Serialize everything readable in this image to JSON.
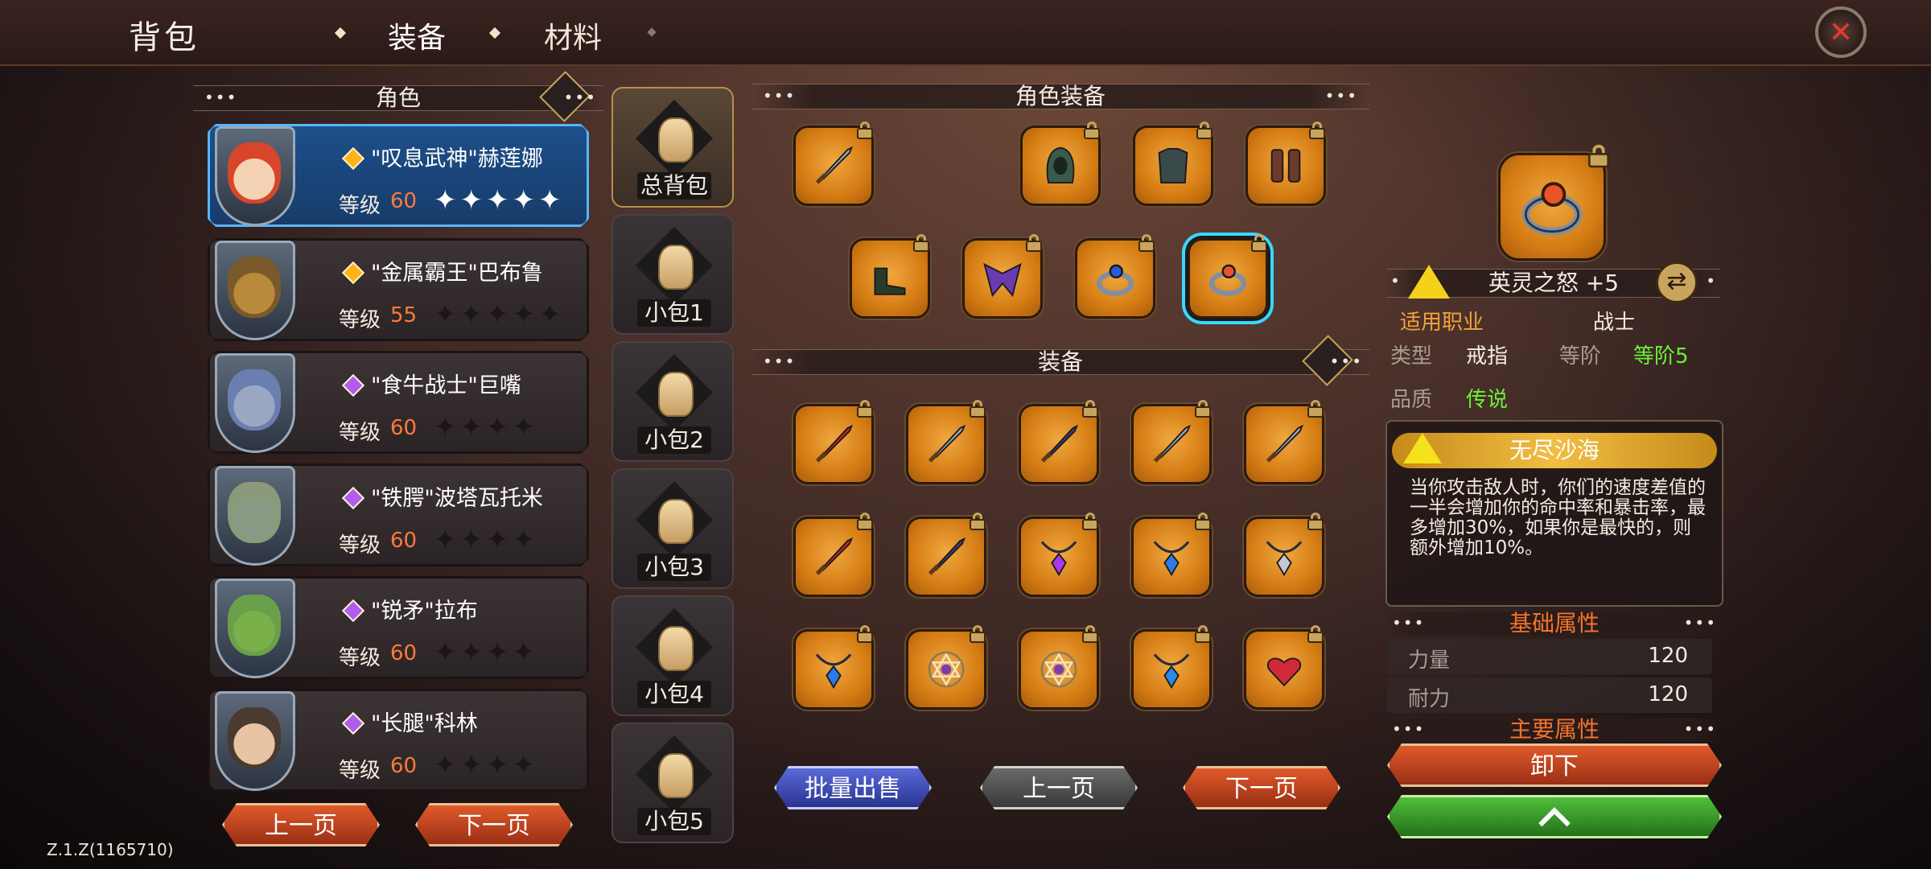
{
  "header": {
    "title": "背包",
    "tabs": [
      {
        "label": "装备",
        "active": true
      },
      {
        "label": "材料",
        "active": false
      }
    ]
  },
  "colors": {
    "accent": "#d9492a",
    "selected_blue": "#56b6ff",
    "gold_rarity": "#ffb21a",
    "purple_rarity": "#b05cf0",
    "level_orange": "#ff7a3a",
    "legend_green": "#6cf03a",
    "class_orange": "#f2a23a"
  },
  "characters_panel": {
    "header": "角色",
    "characters": [
      {
        "name": "\"叹息武神\"赫莲娜",
        "level_label": "等级",
        "level": "60",
        "rarity": "gold",
        "stars_filled": 5,
        "stars_total": 5,
        "selected": true
      },
      {
        "name": "\"金属霸王\"巴布鲁",
        "level_label": "等级",
        "level": "55",
        "rarity": "gold",
        "stars_filled": 0,
        "stars_total": 5,
        "selected": false
      },
      {
        "name": "\"食牛战士\"巨嘴",
        "level_label": "等级",
        "level": "60",
        "rarity": "purple",
        "stars_filled": 0,
        "stars_total": 4,
        "selected": false
      },
      {
        "name": "\"铁腭\"波塔瓦托米",
        "level_label": "等级",
        "level": "60",
        "rarity": "purple",
        "stars_filled": 0,
        "stars_total": 4,
        "selected": false
      },
      {
        "name": "\"锐矛\"拉布",
        "level_label": "等级",
        "level": "60",
        "rarity": "purple",
        "stars_filled": 0,
        "stars_total": 4,
        "selected": false
      },
      {
        "name": "\"长腿\"科林",
        "level_label": "等级",
        "level": "60",
        "rarity": "purple",
        "stars_filled": 0,
        "stars_total": 4,
        "selected": false
      }
    ],
    "prev_label": "上一页",
    "next_label": "下一页"
  },
  "bags": [
    "总背包",
    "小包1",
    "小包2",
    "小包3",
    "小包4",
    "小包5"
  ],
  "equipped": {
    "header": "角色装备",
    "row1": [
      "sword-icon",
      "hood-icon",
      "chest-armor-icon",
      "gauntlets-icon"
    ],
    "row2": [
      "boots-icon",
      "cape-icon",
      "blue-ring-icon",
      "red-ring-icon"
    ]
  },
  "inventory": {
    "header": "装备",
    "items": [
      "red-blade-icon",
      "short-sword-icon",
      "dark-sword-icon",
      "axe-sword-icon",
      "longsword-icon",
      "serrated-blade-icon",
      "purple-greatsword-icon",
      "purple-amulet-icon",
      "blue-amulet-icon",
      "dark-necklace-icon",
      "blue-pendant-icon",
      "star-of-david-icon",
      "star-of-david-icon",
      "sapphire-necklace-icon",
      "heart-amulet-icon"
    ],
    "bulk_sell_label": "批量出售",
    "prev_label": "上一页",
    "next_label": "下一页"
  },
  "detail": {
    "item_name": "英灵之怒 +5",
    "class_label": "适用职业",
    "class_value": "战士",
    "type_label": "类型",
    "type_value": "戒指",
    "tier_label": "等阶",
    "tier_value": "等阶5",
    "quality_label": "品质",
    "quality_value": "传说",
    "set_name": "无尽沙海",
    "description": "当你攻击敌人时，你们的速度差值的一半会增加你的命中率和暴击率，最多增加30%，如果你是最快的，则额外增加10%。",
    "base_header": "基础属性",
    "stats": [
      {
        "label": "力量",
        "value": "120"
      },
      {
        "label": "耐力",
        "value": "120"
      }
    ],
    "main_header": "主要属性",
    "unequip_label": "卸下",
    "upgrade_icon": "chevron-up-icon"
  },
  "version": "Z.1.Z(1165710)"
}
